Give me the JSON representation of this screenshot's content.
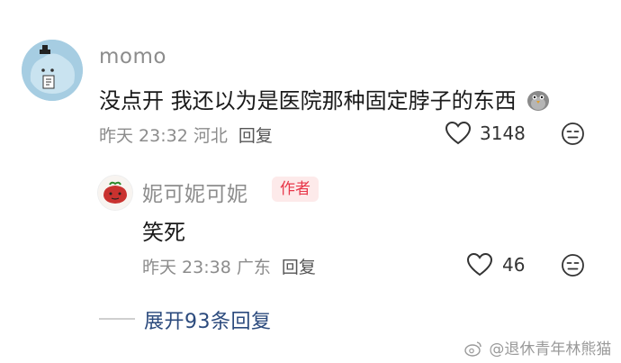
{
  "comment": {
    "username": "momo",
    "text": "没点开 我还以为是医院那种固定脖子的东西",
    "emoji": "pigeon-emoji",
    "time": "昨天 23:32",
    "location": "河北",
    "reply_label": "回复",
    "likes": "3148"
  },
  "reply": {
    "username": "妮可妮可妮",
    "badge": "作者",
    "text": "笑死",
    "time": "昨天 23:38",
    "location": "广东",
    "reply_label": "回复",
    "likes": "46"
  },
  "expand": {
    "label": "展开93条回复"
  },
  "watermark": {
    "text": "@退休青年林熊猫"
  },
  "colors": {
    "accent_badge": "#e8374a",
    "badge_bg": "#fdeaea",
    "expand_link": "#2b4a7d",
    "meta_gray": "#8c8c8c"
  }
}
